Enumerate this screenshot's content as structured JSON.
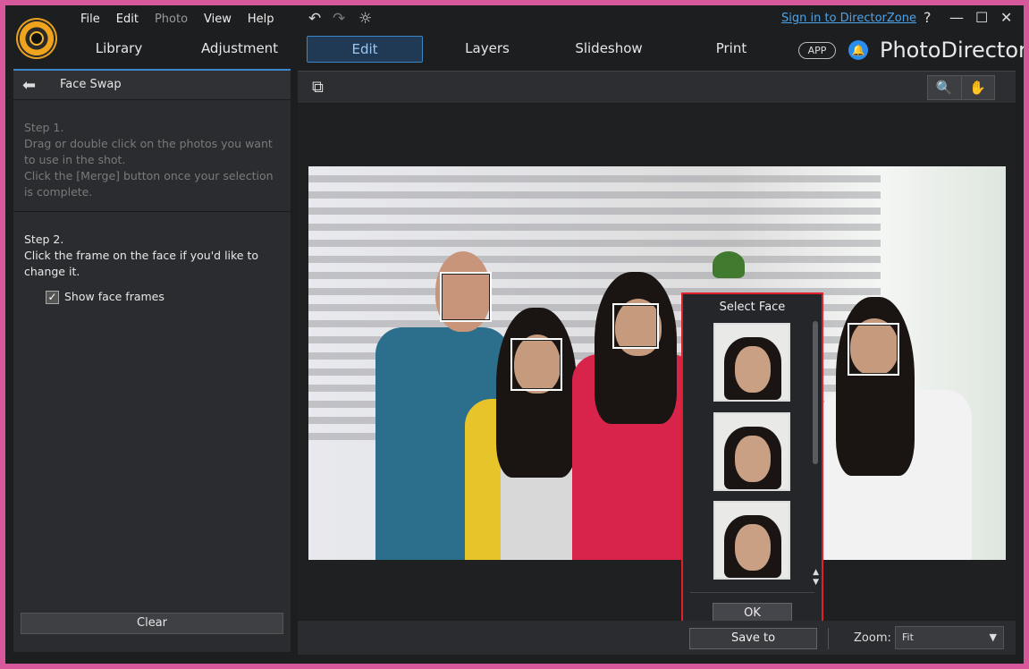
{
  "menu": [
    "File",
    "Edit",
    "Photo",
    "View",
    "Help"
  ],
  "signin_label": "Sign in to DirectorZone",
  "window_controls": {
    "help": "?",
    "minimize": "—",
    "maximize": "☐",
    "close": "✕"
  },
  "tabs": [
    "Library",
    "Adjustment",
    "Edit",
    "Layers",
    "Slideshow",
    "Print"
  ],
  "active_tab": "Edit",
  "app_badge": "APP",
  "brand": "PhotoDirector",
  "panel": {
    "title": "Face Swap",
    "step1_title": "Step 1.",
    "step1_text": "Drag or double click on the photos you want to use in the shot.",
    "step1_text2": "Click the [Merge] button once your selection is complete.",
    "step2_title": "Step 2.",
    "step2_text": "Click the frame on the face if you'd like to change it.",
    "show_frames_label": "Show face frames",
    "show_frames_checked": true,
    "clear_label": "Clear"
  },
  "select_face": {
    "title": "Select Face",
    "ok_label": "OK"
  },
  "bottom": {
    "save_label": "Save to",
    "zoom_label": "Zoom:",
    "zoom_value": "Fit"
  },
  "icons": {
    "back": "back-arrow-icon",
    "undo": "undo-icon",
    "redo": "redo-icon",
    "settings": "gear-icon",
    "magnifier": "magnifier-icon",
    "hand": "hand-icon",
    "bell": "notification-icon"
  },
  "colors": {
    "accent": "#3c86c8",
    "highlight_border": "#e0202a",
    "link": "#4ca3ea"
  }
}
